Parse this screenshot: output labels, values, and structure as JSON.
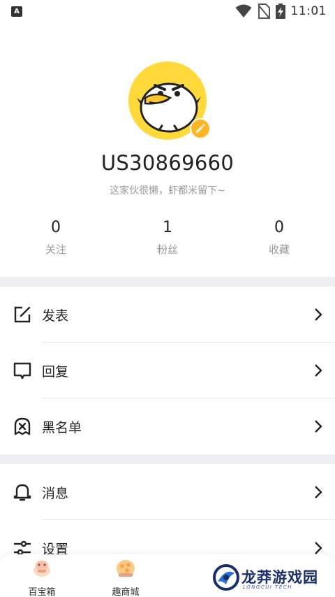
{
  "status_bar": {
    "left_icon": "A",
    "time": "11:01",
    "icons": [
      "wifi-icon",
      "no-sim-icon",
      "battery-charging-icon"
    ]
  },
  "profile": {
    "avatar": "duck-avatar",
    "edit_icon": "pencil-icon",
    "username": "US30869660",
    "bio": "这家伙很懒，虾都米留下~"
  },
  "stats": [
    {
      "value": "0",
      "label": "关注"
    },
    {
      "value": "1",
      "label": "粉丝"
    },
    {
      "value": "0",
      "label": "收藏"
    }
  ],
  "menu": {
    "group1": [
      {
        "label": "发表",
        "icon": "edit-icon"
      },
      {
        "label": "回复",
        "icon": "reply-icon"
      },
      {
        "label": "黑名单",
        "icon": "blacklist-icon"
      }
    ],
    "group2": [
      {
        "label": "消息",
        "icon": "bell-icon"
      },
      {
        "label": "设置",
        "icon": "settings-icon"
      }
    ]
  },
  "bottom_nav": [
    {
      "label": "百宝箱",
      "icon": "treasure-icon"
    },
    {
      "label": "趣商城",
      "icon": "shop-icon"
    }
  ],
  "watermark": {
    "title": "龙莽游戏园",
    "subtitle": "LONGCUI TECH"
  },
  "colors": {
    "accent_yellow": "#FFD83A",
    "edit_badge": "#FFB524",
    "divider": "#efeff3",
    "text_primary": "#222222",
    "text_secondary": "#9a9a9a"
  }
}
